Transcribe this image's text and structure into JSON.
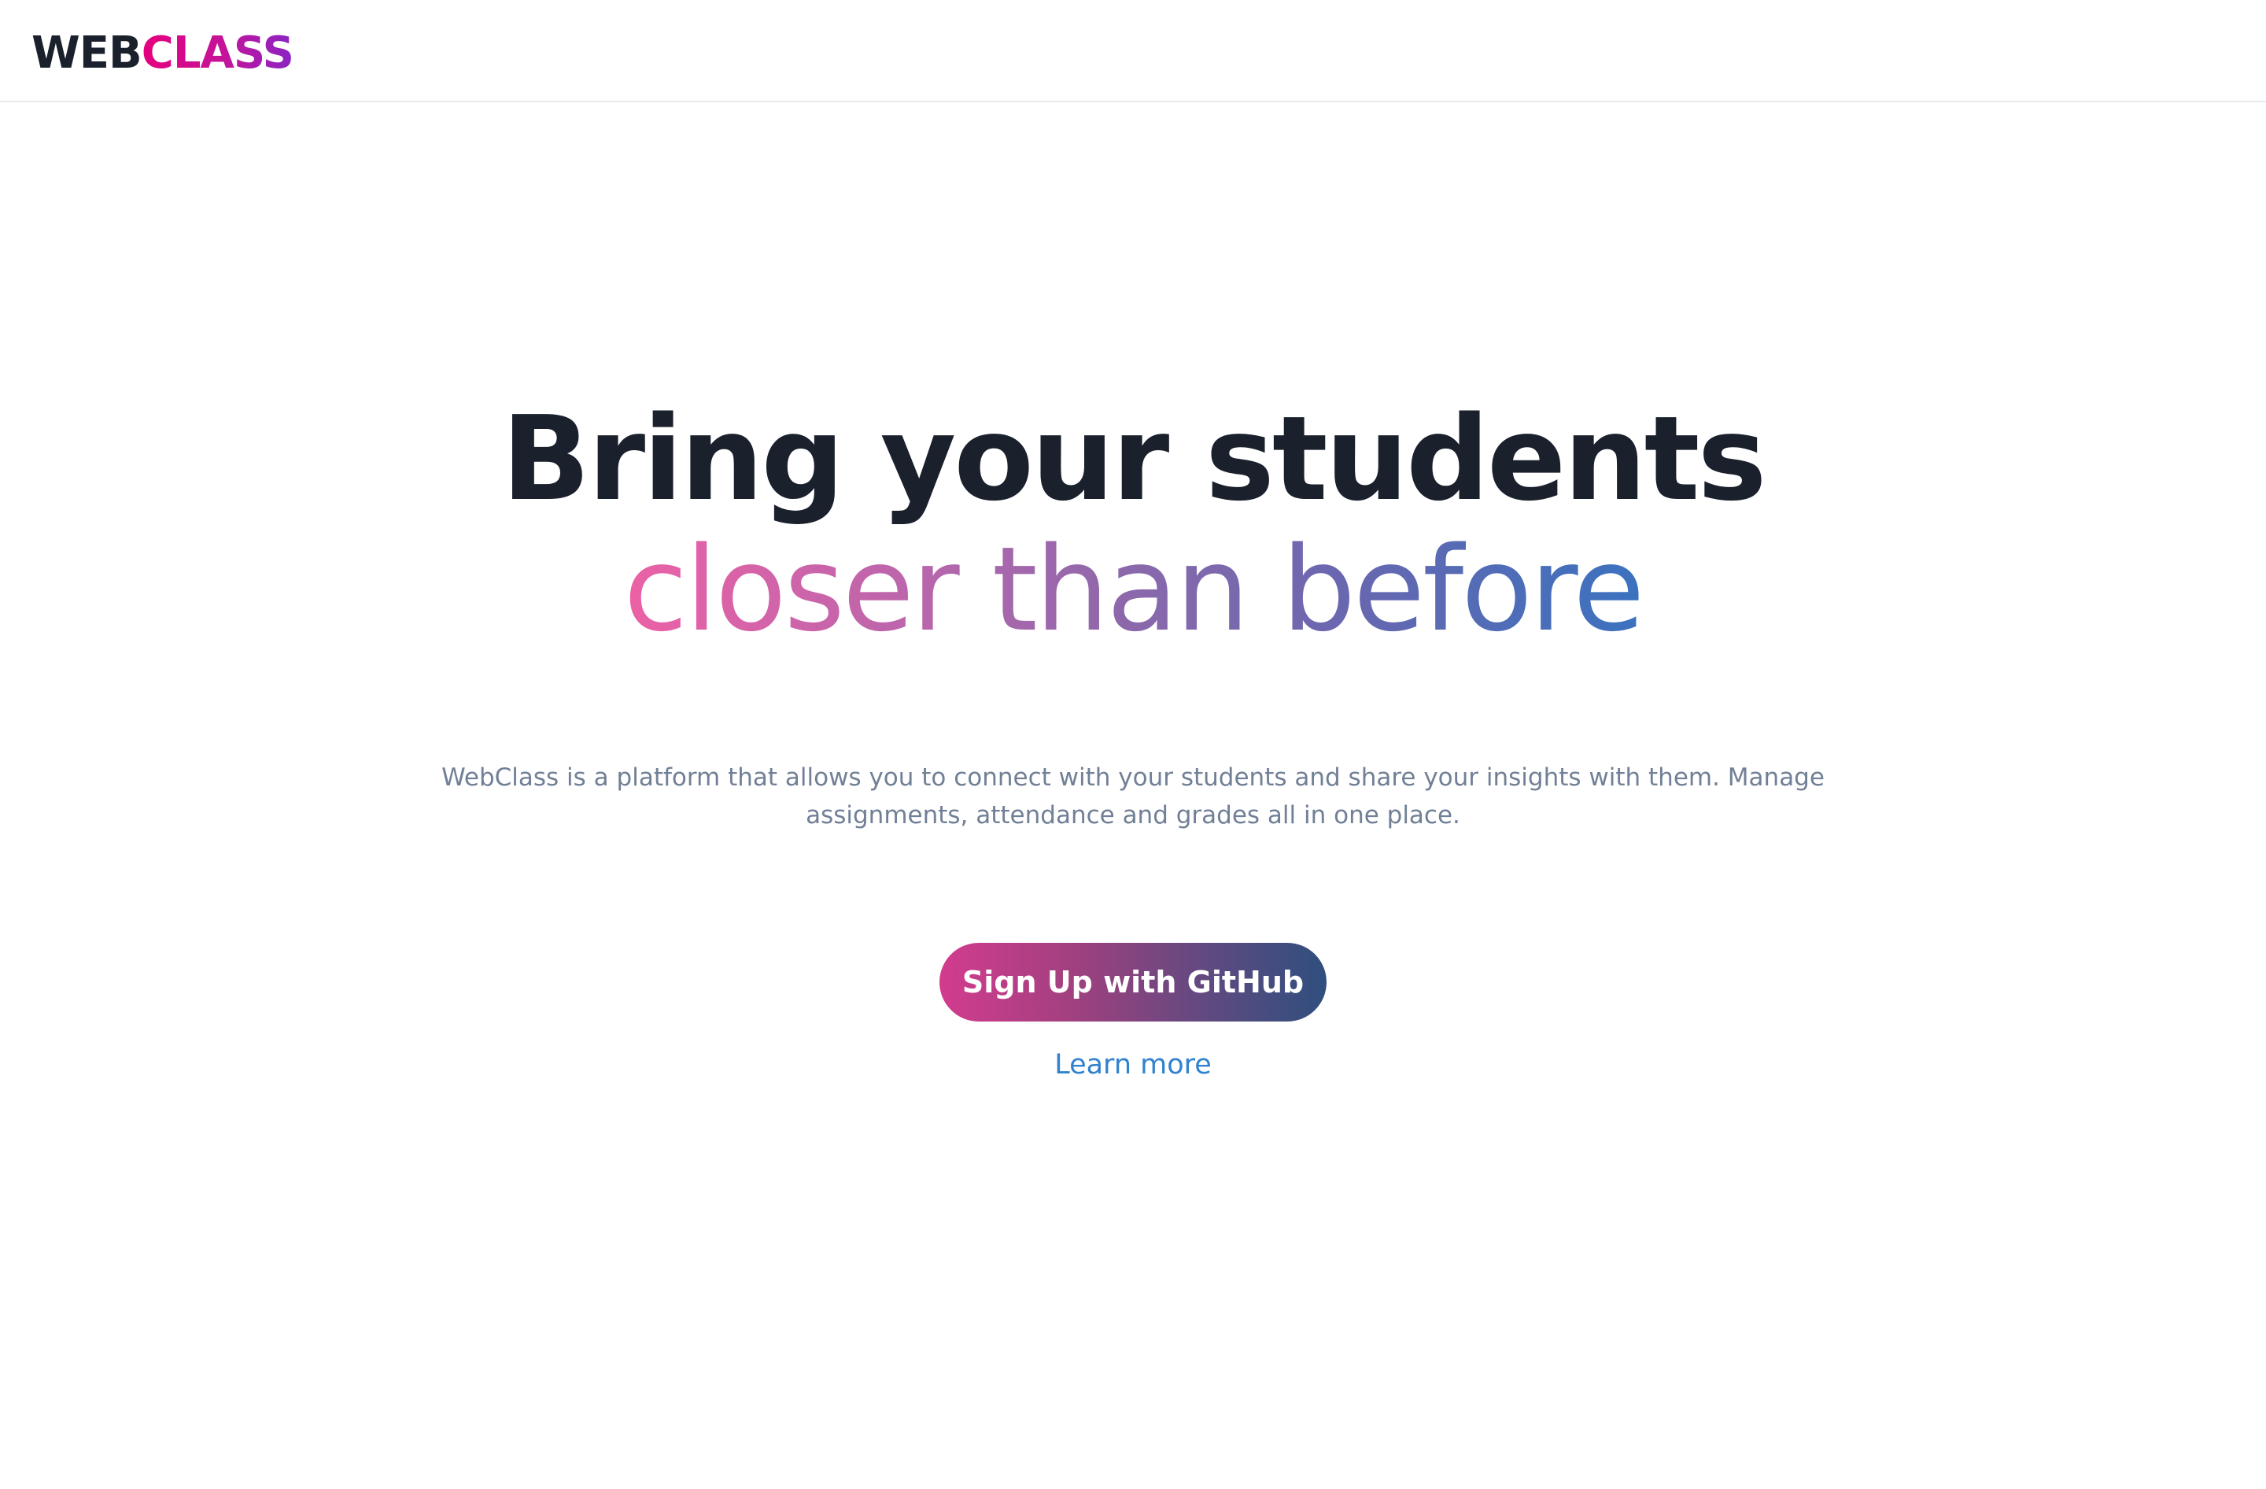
{
  "header": {
    "logo_part1": "WEB",
    "logo_part2": "CLASS"
  },
  "hero": {
    "title_line1": "Bring your students",
    "title_line2": "closer than before",
    "description": "WebClass is a platform that allows you to connect with your students and share your insights with them. Manage assignments, attendance and grades all in one place.",
    "primary_button_label": "Sign Up with GitHub",
    "secondary_link_label": "Learn more"
  },
  "colors": {
    "heading": "#1a202c",
    "logo_gradient": [
      "#e5007d",
      "#8a24c4"
    ],
    "title_gradient": [
      "#ec61a6",
      "#3a72bf"
    ],
    "button_gradient": [
      "#d33c8e",
      "#2f4f7e"
    ],
    "description": "#718096",
    "link": "#3182ce",
    "border": "#e8eaee"
  }
}
